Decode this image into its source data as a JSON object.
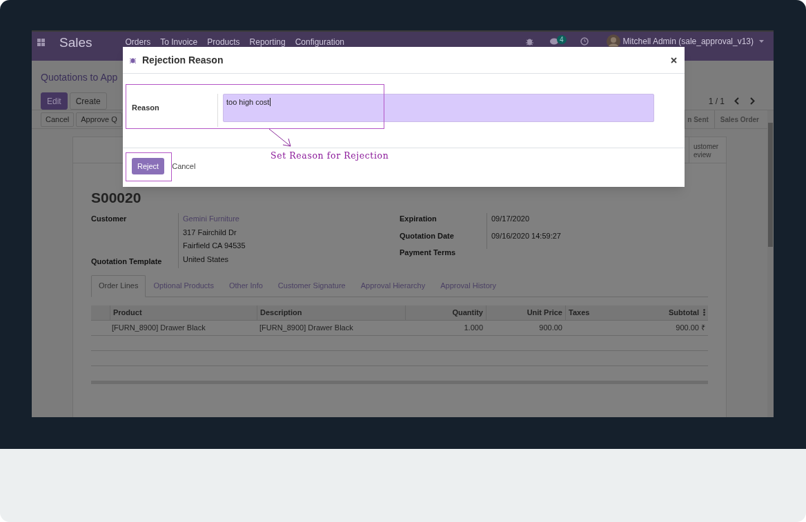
{
  "navbar": {
    "app": "Sales",
    "menu": [
      "Orders",
      "To Invoice",
      "Products",
      "Reporting",
      "Configuration"
    ],
    "chat_badge": "4",
    "user": "Mitchell Admin (sale_approval_v13)"
  },
  "control_panel": {
    "breadcrumb": "Quotations to App",
    "buttons": [
      {
        "label": "Edit",
        "kind": "primary"
      },
      {
        "label": "Create",
        "kind": "secondary"
      }
    ],
    "pager": "1 / 1"
  },
  "actions": [
    "Cancel",
    "Approve Q"
  ],
  "statusbar": [
    "n Sent",
    "Sales Order"
  ],
  "form": {
    "smart_button": "ustomer eview",
    "name": "S00020",
    "customer": {
      "label": "Customer",
      "name": "Gemini Furniture",
      "address": [
        "317 Fairchild Dr",
        "Fairfield CA 94535",
        "United States"
      ]
    },
    "template_label": "Quotation Template",
    "right_fields": [
      {
        "label": "Expiration",
        "value": "09/17/2020"
      },
      {
        "label": "Quotation Date",
        "value": "09/16/2020 14:59:27"
      },
      {
        "label": "Payment Terms"
      }
    ],
    "tabs": [
      {
        "label": "Order Lines",
        "selected": true
      },
      {
        "label": "Optional Products",
        "selected": false
      },
      {
        "label": "Other Info",
        "selected": false
      },
      {
        "label": "Customer Signature",
        "selected": false
      },
      {
        "label": "Approval Hierarchy",
        "selected": false
      },
      {
        "label": "Approval History",
        "selected": false
      }
    ],
    "table": {
      "columns": [
        "Product",
        "Description",
        "Quantity",
        "Unit Price",
        "Taxes",
        "Subtotal"
      ],
      "rows": [
        {
          "product": "[FURN_8900] Drawer Black",
          "description": "[FURN_8900] Drawer Black",
          "quantity": "1.000",
          "unit_price": "900.00",
          "subtotal": "900.00 ₹"
        }
      ]
    }
  },
  "dialog": {
    "title": "Rejection Reason",
    "field_label": "Reason",
    "value": "too high cost",
    "buttons": [
      {
        "label": "Reject",
        "kind": "primary"
      },
      {
        "label": "Cancel",
        "kind": "link"
      }
    ]
  },
  "annotation": {
    "text": "Set Reason for Rejection"
  }
}
